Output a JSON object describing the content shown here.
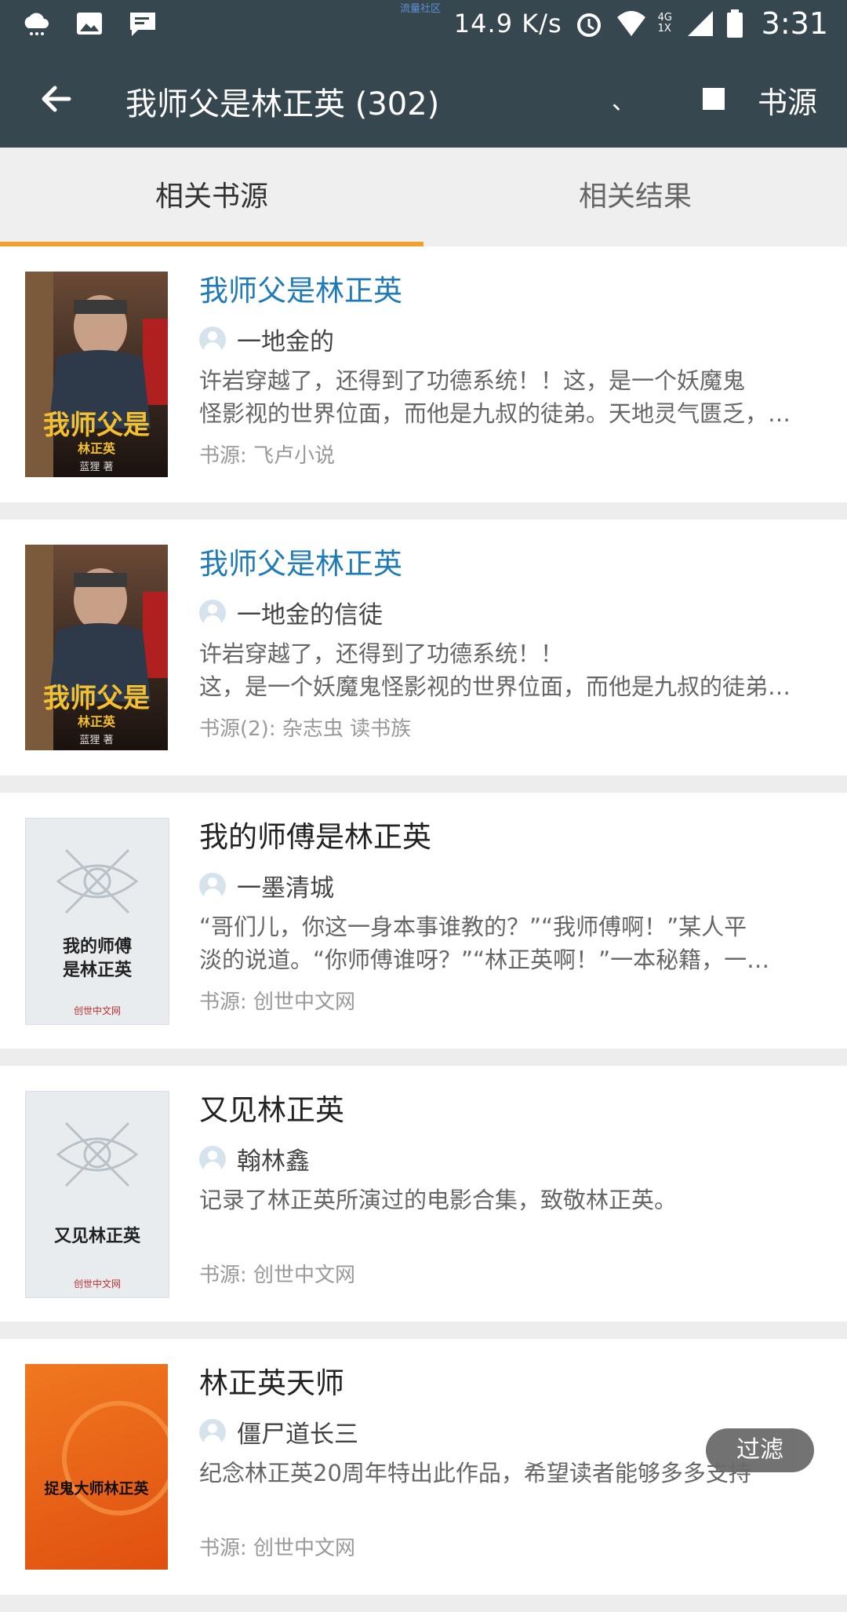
{
  "status_bar": {
    "community": "流量社区",
    "speed": "14.9 K/s",
    "network": "4G 1X",
    "time": "3:31",
    "icons": [
      "cloud-icon",
      "image-icon",
      "message-icon",
      "alarm-icon",
      "wifi-icon",
      "signal-icon",
      "battery-icon"
    ]
  },
  "app_bar": {
    "title": "我师父是林正英 (302)",
    "dot": "、",
    "source_label": "书源"
  },
  "tabs": [
    {
      "label": "相关书源",
      "active": true
    },
    {
      "label": "相关结果",
      "active": false
    }
  ],
  "books": [
    {
      "title": "我师父是林正英",
      "author": "一地金的",
      "desc_lines": [
        "许岩穿越了，还得到了功德系统！！这，是一个妖魔鬼",
        "怪影视的世界位面，而他是九叔的徒弟。天地灵气匮乏，…"
      ],
      "source": "书源: 飞卢小说",
      "cover_text": "我师父是",
      "cover_sub": "林正英",
      "cover_author": "蓝狸 著"
    },
    {
      "title": "我师父是林正英",
      "author": "一地金的信徒",
      "desc_lines": [
        "许岩穿越了，还得到了功德系统！！",
        "这，是一个妖魔鬼怪影视的世界位面，而他是九叔的徒弟…"
      ],
      "source": "书源(2): 杂志虫 读书族",
      "cover_text": "我师父是",
      "cover_sub": "林正英",
      "cover_author": "蓝狸 著"
    },
    {
      "title": "我的师傅是林正英",
      "author": "一墨清城",
      "desc_lines": [
        "“哥们儿，你这一身本事谁教的？”“我师傅啊！”某人平",
        "淡的说道。“你师傅谁呀？”“林正英啊！”一本秘籍，一…"
      ],
      "source": "书源: 创世中文网",
      "cover_text": "我的师傅\n是林正英",
      "cover_brand": "创世中文网"
    },
    {
      "title": "又见林正英",
      "author": "翰林鑫",
      "desc_lines": [
        "记录了林正英所演过的电影合集，致敬林正英。"
      ],
      "source": "书源: 创世中文网",
      "cover_text": "又见林正英",
      "cover_brand": "创世中文网"
    },
    {
      "title": "林正英天师",
      "author": "僵尸道长三",
      "desc_lines": [
        "纪念林正英20周年特出此作品，希望读者能够多多支持"
      ],
      "source": "书源: 创世中文网",
      "cover_text": "捉鬼大师林正英"
    }
  ],
  "filter_label": "过滤",
  "colors": {
    "bar": "#37474f",
    "accent": "#f0a030",
    "link": "#1e7bb8"
  }
}
